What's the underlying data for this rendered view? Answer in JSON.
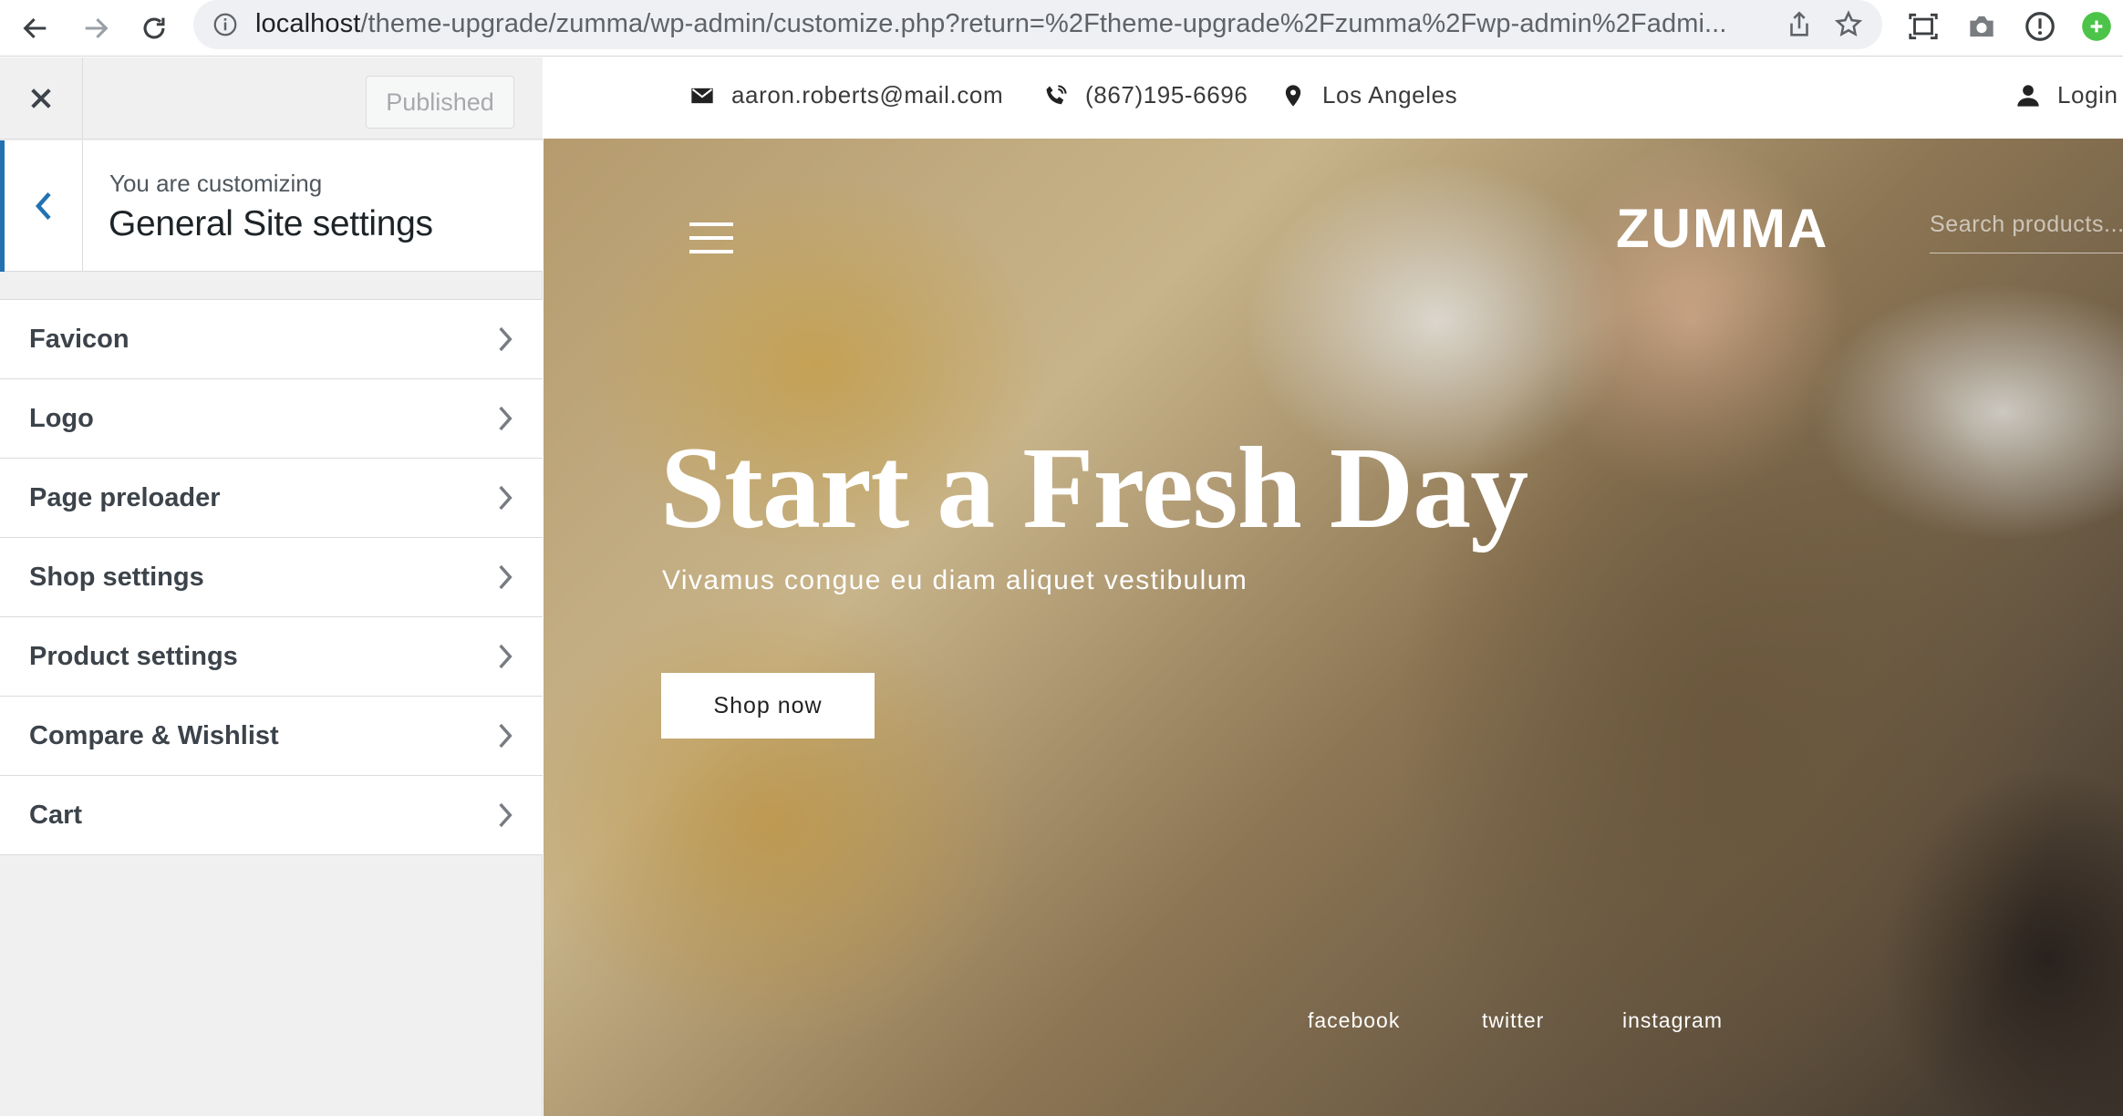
{
  "browser": {
    "url_host": "localhost",
    "url_path": "/theme-upgrade/zumma/wp-admin/customize.php?return=%2Ftheme-upgrade%2Fzumma%2Fwp-admin%2Fadmi..."
  },
  "customizer": {
    "publish_label": "Published",
    "customizing_label": "You are customizing",
    "section_title": "General Site settings",
    "items": [
      {
        "label": "Favicon"
      },
      {
        "label": "Logo"
      },
      {
        "label": "Page preloader"
      },
      {
        "label": "Shop settings"
      },
      {
        "label": "Product settings"
      },
      {
        "label": "Compare & Wishlist"
      },
      {
        "label": "Cart"
      }
    ],
    "accent_color": "#2271b1"
  },
  "preview": {
    "topbar": {
      "email": "aaron.roberts@mail.com",
      "phone": "(867)195-6696",
      "location": "Los Angeles",
      "login": "Login"
    },
    "brand": "ZUMMA",
    "search_placeholder": "Search products...",
    "hero": {
      "title": "Start a Fresh Day",
      "subtitle": "Vivamus congue eu diam aliquet vestibulum",
      "cta": "Shop now"
    },
    "social": [
      "facebook",
      "twitter",
      "instagram"
    ]
  }
}
